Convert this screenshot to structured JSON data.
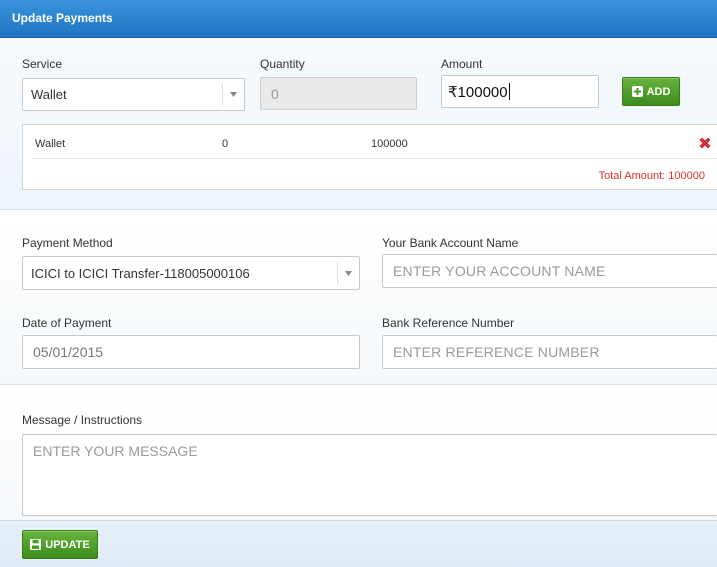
{
  "header": {
    "title": "Update Payments"
  },
  "service_section": {
    "service_label": "Service",
    "service_value": "Wallet",
    "quantity_label": "Quantity",
    "quantity_value": "0",
    "amount_label": "Amount",
    "amount_value": "₹100000",
    "add_button": "ADD",
    "rows": [
      {
        "service": "Wallet",
        "quantity": "0",
        "amount": "100000"
      }
    ],
    "total": "Total Amount: 100000"
  },
  "payment_section": {
    "method_label": "Payment Method",
    "method_value": "ICICI to ICICI Transfer-118005000106",
    "account_label": "Your Bank Account Name",
    "account_placeholder": "ENTER YOUR ACCOUNT NAME",
    "date_label": "Date of Payment",
    "date_value": "05/01/2015",
    "reference_label": "Bank Reference Number",
    "reference_placeholder": "ENTER REFERENCE NUMBER"
  },
  "message_section": {
    "label": "Message / Instructions",
    "placeholder": "ENTER YOUR MESSAGE"
  },
  "footer": {
    "update_button": "UPDATE"
  },
  "colors": {
    "header_blue": "#2a84d2",
    "button_green": "#4f9f2a",
    "total_red": "#e03030",
    "delete_red": "#e0303a"
  },
  "icons": {
    "add": "plus-square-icon",
    "delete": "x-mark-icon",
    "update": "floppy-disk-icon",
    "dropdown": "chevron-down-icon"
  }
}
